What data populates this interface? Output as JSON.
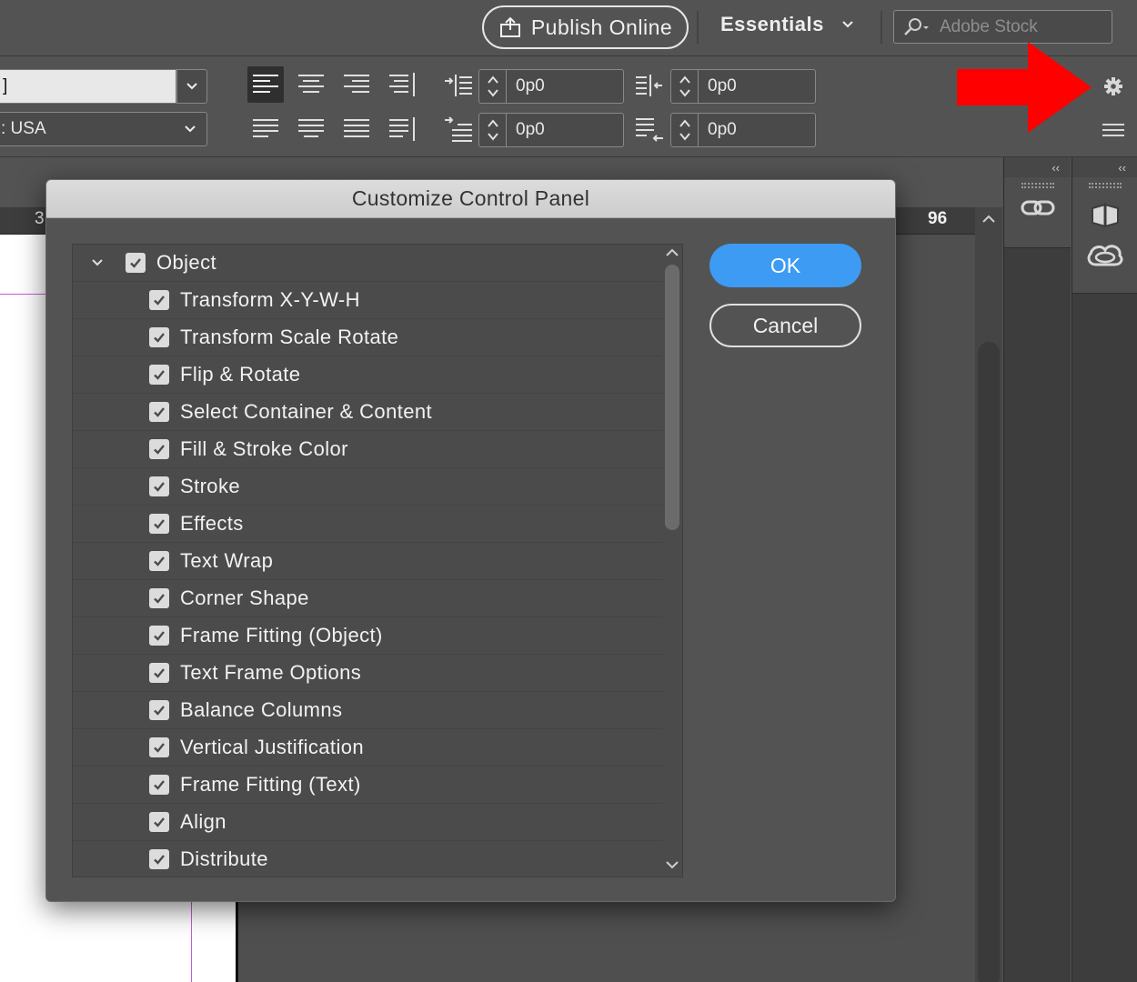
{
  "appbar": {
    "publish_label": "Publish Online",
    "workspace_label": "Essentials",
    "search_placeholder": "Adobe Stock"
  },
  "control_panel": {
    "font_value": "]",
    "language_value": ": USA",
    "spinners": [
      {
        "value": "0p0"
      },
      {
        "value": "0p0"
      },
      {
        "value": "0p0"
      },
      {
        "value": "0p0"
      }
    ]
  },
  "ruler": {
    "left_number": "3",
    "right_number": "96"
  },
  "dock": {
    "collapse_glyph": "‹‹"
  },
  "dialog": {
    "title": "Customize Control Panel",
    "ok_label": "OK",
    "cancel_label": "Cancel",
    "group": {
      "label": "Object",
      "checked": true,
      "expanded": true
    },
    "items": [
      {
        "label": "Transform X-Y-W-H",
        "checked": true
      },
      {
        "label": "Transform Scale Rotate",
        "checked": true
      },
      {
        "label": "Flip & Rotate",
        "checked": true
      },
      {
        "label": "Select Container & Content",
        "checked": true
      },
      {
        "label": "Fill & Stroke Color",
        "checked": true
      },
      {
        "label": "Stroke",
        "checked": true
      },
      {
        "label": "Effects",
        "checked": true
      },
      {
        "label": "Text Wrap",
        "checked": true
      },
      {
        "label": "Corner Shape",
        "checked": true
      },
      {
        "label": "Frame Fitting (Object)",
        "checked": true
      },
      {
        "label": "Text Frame Options",
        "checked": true
      },
      {
        "label": "Balance Columns",
        "checked": true
      },
      {
        "label": "Vertical Justification",
        "checked": true
      },
      {
        "label": "Frame Fitting (Text)",
        "checked": true
      },
      {
        "label": "Align",
        "checked": true
      },
      {
        "label": "Distribute",
        "checked": true
      }
    ]
  },
  "colors": {
    "accent": "#3d9bf3",
    "annotation_arrow": "#ff0000",
    "guide": "#c65ad9"
  }
}
